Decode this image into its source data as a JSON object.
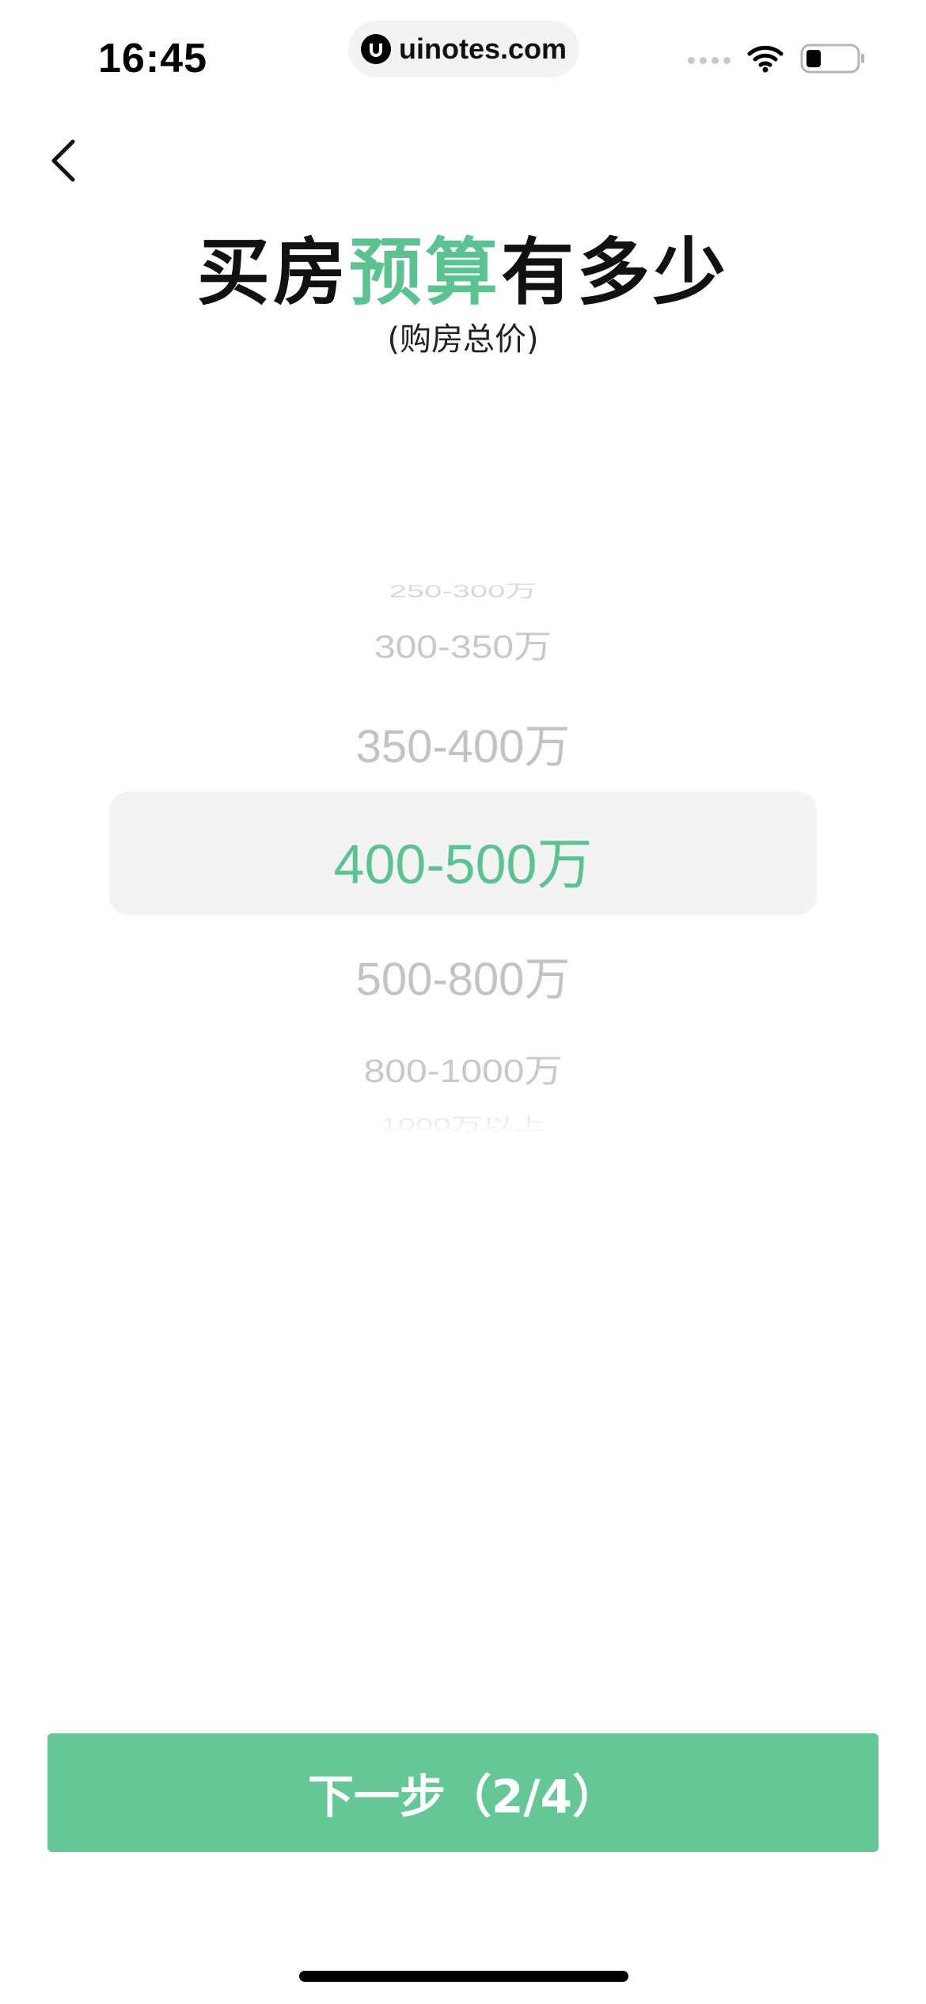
{
  "status_bar": {
    "time": "16:45",
    "url": "uinotes.com"
  },
  "header": {
    "title_part1": "买房",
    "title_accent": "预算",
    "title_part2": "有多少",
    "subtitle": "(购房总价)"
  },
  "picker": {
    "options": [
      "250-300万",
      "300-350万",
      "350-400万",
      "400-500万",
      "500-800万",
      "800-1000万",
      "1000万以上"
    ],
    "selected": "400-500万"
  },
  "next_button": {
    "label": "下一步（2/4）"
  },
  "colors": {
    "accent": "#5cc292",
    "button": "#65c795",
    "unselected": "#c3c3c3",
    "highlight_bg": "#f3f3f3"
  }
}
